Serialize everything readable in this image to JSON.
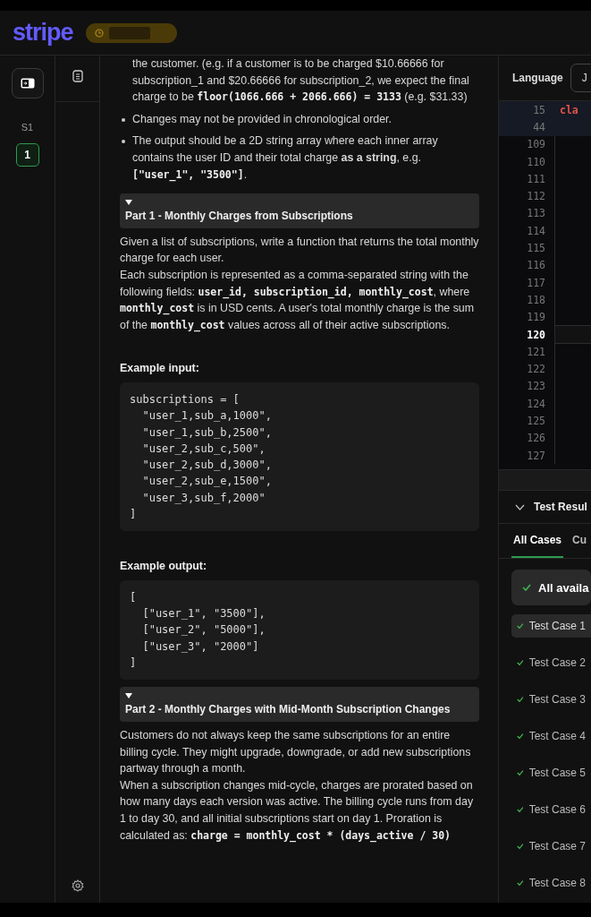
{
  "header": {
    "logo": "stripe"
  },
  "rail": {
    "section_label": "S1",
    "items": [
      {
        "label": "1",
        "selected": true
      }
    ]
  },
  "description": [
    {
      "kind": "continuation",
      "segments": [
        {
          "kind": "text",
          "text": "the customer. (e.g. if a customer is to be charged $10.66666 for subscription_1 and $20.66666 for subscription_2, we expect the final charge to be "
        },
        {
          "kind": "code",
          "text": "floor(1066.666 + 2066.666) = 3133"
        },
        {
          "kind": "text",
          "text": " (e.g. $31.33)"
        }
      ]
    },
    {
      "kind": "bullet",
      "segments": [
        {
          "kind": "text",
          "text": "Changes may not be provided in chronological order."
        }
      ]
    },
    {
      "kind": "bullet",
      "segments": [
        {
          "kind": "text",
          "text": "The output should be a 2D string array where each inner array contains the user ID and their total charge "
        },
        {
          "kind": "bold",
          "text": "as a string"
        },
        {
          "kind": "text",
          "text": ", e.g. "
        },
        {
          "kind": "code",
          "text": "[\"user_1\", \"3500\"]"
        },
        {
          "kind": "text",
          "text": "."
        }
      ]
    },
    {
      "kind": "heading",
      "title": "Part 1 - Monthly Charges from Subscriptions",
      "expanded": true
    },
    {
      "kind": "paragraph",
      "segments": [
        {
          "kind": "text",
          "text": "Given a list of subscriptions, write a function that returns the total monthly charge for each user."
        }
      ]
    },
    {
      "kind": "paragraph",
      "segments": [
        {
          "kind": "text",
          "text": "Each subscription is represented as a comma-separated string with the following fields: "
        },
        {
          "kind": "code",
          "text": "user_id, subscription_id, monthly_cost"
        },
        {
          "kind": "text",
          "text": ", where "
        },
        {
          "kind": "code",
          "text": "monthly_cost"
        },
        {
          "kind": "text",
          "text": " is in USD cents. A user's total monthly charge is the sum of the "
        },
        {
          "kind": "code",
          "text": "monthly_cost"
        },
        {
          "kind": "text",
          "text": " values across all of their active subscriptions."
        }
      ]
    },
    {
      "kind": "label",
      "text": "Example input:"
    },
    {
      "kind": "code",
      "lines": [
        "subscriptions = [",
        "  \"user_1,sub_a,1000\",",
        "  \"user_1,sub_b,2500\",",
        "  \"user_2,sub_c,500\",",
        "  \"user_2,sub_d,3000\",",
        "  \"user_2,sub_e,1500\",",
        "  \"user_3,sub_f,2000\"",
        "]"
      ]
    },
    {
      "kind": "label",
      "text": "Example output:"
    },
    {
      "kind": "code",
      "lines": [
        "[",
        "  [\"user_1\", \"3500\"],",
        "  [\"user_2\", \"5000\"],",
        "  [\"user_3\", \"2000\"]",
        "]"
      ]
    },
    {
      "kind": "heading",
      "title": "Part 2 - Monthly Charges with Mid-Month Subscription Changes",
      "expanded": true
    },
    {
      "kind": "paragraph",
      "segments": [
        {
          "kind": "text",
          "text": "Customers do not always keep the same subscriptions for an entire billing cycle. They might upgrade, downgrade, or add new subscriptions partway through a month."
        }
      ]
    },
    {
      "kind": "paragraph",
      "segments": [
        {
          "kind": "text",
          "text": "When a subscription changes mid-cycle, charges are prorated based on how many days each version was active. The billing cycle runs from day 1 to day 30, and all initial subscriptions start on day 1. Proration is calculated as: "
        },
        {
          "kind": "code",
          "text": "charge = monthly_cost * (days_active / 30)"
        }
      ]
    }
  ],
  "editor": {
    "language_label": "Language",
    "language_value": "J",
    "lines": [
      {
        "number": "15",
        "kind": "sticky",
        "code": "cla",
        "selected": false
      },
      {
        "number": "44",
        "kind": "sticky",
        "selected": false
      },
      {
        "number": "109",
        "kind": "normal",
        "selected": false
      },
      {
        "number": "110",
        "kind": "normal",
        "selected": false
      },
      {
        "number": "111",
        "kind": "normal",
        "selected": false
      },
      {
        "number": "112",
        "kind": "normal",
        "selected": false
      },
      {
        "number": "113",
        "kind": "normal",
        "selected": false
      },
      {
        "number": "114",
        "kind": "normal",
        "selected": false
      },
      {
        "number": "115",
        "kind": "normal",
        "selected": false
      },
      {
        "number": "116",
        "kind": "normal",
        "selected": false
      },
      {
        "number": "117",
        "kind": "normal",
        "selected": false
      },
      {
        "number": "118",
        "kind": "normal",
        "selected": false
      },
      {
        "number": "119",
        "kind": "normal",
        "selected": false
      },
      {
        "number": "120",
        "kind": "normal",
        "selected": true
      },
      {
        "number": "121",
        "kind": "normal",
        "selected": false
      },
      {
        "number": "122",
        "kind": "normal",
        "selected": false
      },
      {
        "number": "123",
        "kind": "normal",
        "selected": false
      },
      {
        "number": "124",
        "kind": "normal",
        "selected": false
      },
      {
        "number": "125",
        "kind": "normal",
        "selected": false
      },
      {
        "number": "126",
        "kind": "normal",
        "selected": false
      },
      {
        "number": "127",
        "kind": "normal",
        "selected": false
      }
    ]
  },
  "tests": {
    "title": "Test Resul",
    "expanded": true,
    "tabs": [
      {
        "label": "All Cases",
        "selected": true
      },
      {
        "label": "Cu",
        "selected": false
      }
    ],
    "banner": "All availa",
    "cases": [
      {
        "label": "Test Case 1",
        "passed": true,
        "selected": true
      },
      {
        "label": "Test Case 2",
        "passed": true,
        "selected": false
      },
      {
        "label": "Test Case 3",
        "passed": true,
        "selected": false
      },
      {
        "label": "Test Case 4",
        "passed": true,
        "selected": false
      },
      {
        "label": "Test Case 5",
        "passed": true,
        "selected": false
      },
      {
        "label": "Test Case 6",
        "passed": true,
        "selected": false
      },
      {
        "label": "Test Case 7",
        "passed": true,
        "selected": false
      },
      {
        "label": "Test Case 8",
        "passed": true,
        "selected": false
      }
    ]
  }
}
